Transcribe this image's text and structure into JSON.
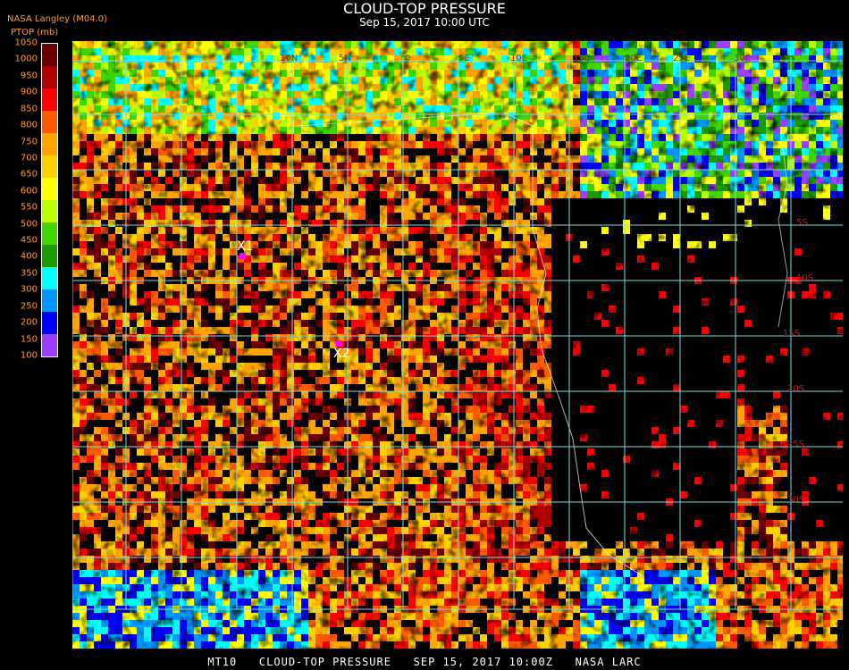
{
  "header": {
    "title": "CLOUD-TOP PRESSURE",
    "subtitle": "Sep 15, 2017 10:00 UTC",
    "source": "NASA Langley (M04.0)",
    "unit": "PTOP (mb)"
  },
  "colorbar": {
    "ticks": [
      "1050",
      "1000",
      "950",
      "900",
      "850",
      "800",
      "750",
      "700",
      "650",
      "600",
      "550",
      "500",
      "450",
      "400",
      "350",
      "300",
      "250",
      "200",
      "150",
      "100"
    ],
    "colors": [
      "#6a0000",
      "#b00000",
      "#ff0000",
      "#ff5a00",
      "#ffa500",
      "#ffd000",
      "#ffff00",
      "#b8ff00",
      "#3fd600",
      "#1a9a00",
      "#00ffff",
      "#0096ff",
      "#0000ff",
      "#9b40ff"
    ]
  },
  "map": {
    "grid_labels": [
      "10N",
      "5N",
      "0",
      "5E",
      "10E",
      "15E",
      "20E",
      "25E",
      "30E",
      "5S",
      "10S",
      "15S",
      "20S",
      "25S",
      "30S"
    ],
    "markers": [
      {
        "label": "X1",
        "color": "#ff00ff"
      },
      {
        "label": "X2",
        "color": "#ff00ff"
      }
    ]
  },
  "footer": "MT10   CLOUD-TOP PRESSURE   SEP 15, 2017 10:00Z   NASA LARC"
}
